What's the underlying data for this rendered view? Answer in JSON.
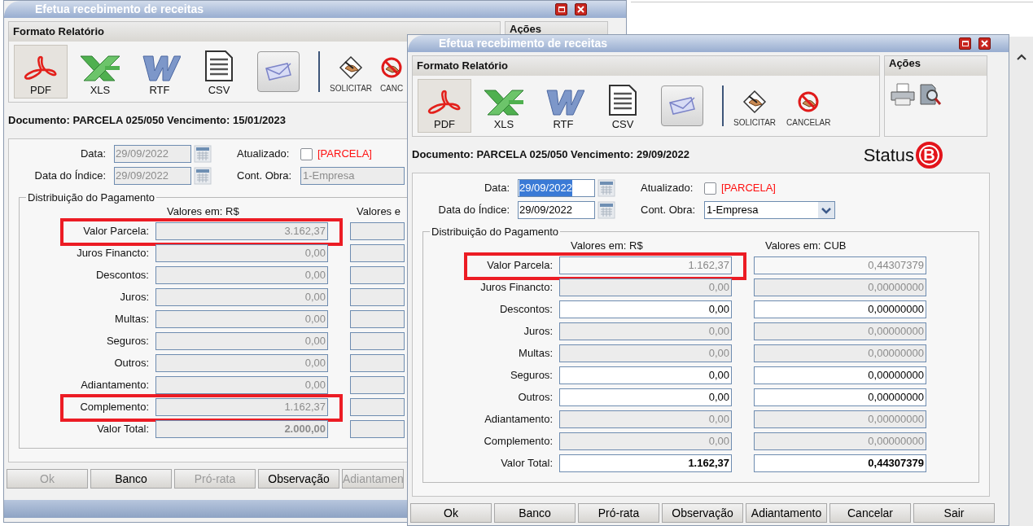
{
  "windows": [
    {
      "title": "Efetua recebimento de receitas",
      "report_panel": {
        "title": "Formato Relatório",
        "formats": [
          {
            "label": "PDF",
            "kind": "pdf",
            "selected": true
          },
          {
            "label": "XLS",
            "kind": "xls",
            "selected": false
          },
          {
            "label": "RTF",
            "kind": "rtf",
            "selected": false
          },
          {
            "label": "CSV",
            "kind": "csv",
            "selected": false
          },
          {
            "kind": "email",
            "selected": false
          }
        ],
        "actions": [
          {
            "label": "SOLICITAR",
            "kind": "request"
          },
          {
            "label": "CANC",
            "kind": "cancel"
          }
        ]
      },
      "actions_panel": {
        "title": "Ações"
      },
      "document": "Documento: PARCELA 025/050 Vencimento: 15/01/2023",
      "date_fields": [
        {
          "label": "Data:",
          "value": "29/09/2022",
          "disabled": true,
          "selected": false
        },
        {
          "label": "Data do Índice:",
          "value": "29/09/2022",
          "disabled": true,
          "selected": false
        }
      ],
      "updated": {
        "label": "Atualizado:",
        "checked": false,
        "note": "[PARCELA]"
      },
      "cont_obra": {
        "label": "Cont. Obra:",
        "value": "1-Empresa",
        "disabled": true
      },
      "distribution": {
        "title": "Distribuição do Pagamento",
        "column_headers": [
          "Valores em: R$",
          "Valores e"
        ],
        "rows": [
          {
            "label": "Valor Parcela:",
            "brl": "3.162,37",
            "kind": "disabled",
            "bold": false,
            "highlighted": true
          },
          {
            "label": "Juros Financto:",
            "brl": "0,00",
            "kind": "disabled",
            "bold": false,
            "highlighted": false
          },
          {
            "label": "Descontos:",
            "brl": "0,00",
            "kind": "disabled",
            "bold": false,
            "highlighted": false
          },
          {
            "label": "Juros:",
            "brl": "0,00",
            "kind": "disabled",
            "bold": false,
            "highlighted": false
          },
          {
            "label": "Multas:",
            "brl": "0,00",
            "kind": "disabled",
            "bold": false,
            "highlighted": false
          },
          {
            "label": "Seguros:",
            "brl": "0,00",
            "kind": "disabled",
            "bold": false,
            "highlighted": false
          },
          {
            "label": "Outros:",
            "brl": "0,00",
            "kind": "disabled",
            "bold": false,
            "highlighted": false
          },
          {
            "label": "Adiantamento:",
            "brl": "0,00",
            "kind": "disabled",
            "bold": false,
            "highlighted": false
          },
          {
            "label": "Complemento:",
            "brl": "1.162,37",
            "kind": "disabled",
            "bold": false,
            "highlighted": true
          },
          {
            "label": "Valor Total:",
            "brl": "2.000,00",
            "kind": "disabled",
            "bold": true,
            "highlighted": false
          }
        ]
      },
      "buttons": [
        {
          "label": "Ok",
          "disabled": true
        },
        {
          "label": "Banco",
          "disabled": false
        },
        {
          "label": "Pró-rata",
          "disabled": true
        },
        {
          "label": "Observação",
          "disabled": false
        },
        {
          "label": "Adiantamen",
          "disabled": true
        }
      ]
    },
    {
      "title": "Efetua recebimento de receitas",
      "report_panel": {
        "title": "Formato Relatório",
        "formats": [
          {
            "label": "PDF",
            "kind": "pdf",
            "selected": true
          },
          {
            "label": "XLS",
            "kind": "xls",
            "selected": false
          },
          {
            "label": "RTF",
            "kind": "rtf",
            "selected": false
          },
          {
            "label": "CSV",
            "kind": "csv",
            "selected": false
          },
          {
            "kind": "email",
            "selected": false
          }
        ],
        "actions": [
          {
            "label": "SOLICITAR",
            "kind": "request"
          },
          {
            "label": "CANCELAR",
            "kind": "cancel"
          }
        ]
      },
      "actions_panel": {
        "title": "Ações",
        "items": [
          {
            "kind": "print"
          },
          {
            "kind": "preview"
          }
        ]
      },
      "document": "Documento: PARCELA 025/050 Vencimento: 29/09/2022",
      "status": {
        "label": "Status",
        "badge": "B"
      },
      "date_fields": [
        {
          "label": "Data:",
          "value": "29/09/2022",
          "disabled": false,
          "selected": true
        },
        {
          "label": "Data do Índice:",
          "value": "29/09/2022",
          "disabled": false,
          "selected": false
        }
      ],
      "updated": {
        "label": "Atualizado:",
        "checked": false,
        "note": "[PARCELA]"
      },
      "cont_obra": {
        "label": "Cont. Obra:",
        "value": "1-Empresa",
        "disabled": false
      },
      "distribution": {
        "title": "Distribuição do Pagamento",
        "column_headers": [
          "Valores em: R$",
          "Valores em: CUB"
        ],
        "rows": [
          {
            "label": "Valor Parcela:",
            "brl": "1.162,37",
            "cub": "0,44307379",
            "kind": "readonly",
            "bold": false,
            "highlighted": true
          },
          {
            "label": "Juros Financto:",
            "brl": "0,00",
            "cub": "0,00000000",
            "kind": "disabled",
            "bold": false,
            "highlighted": false
          },
          {
            "label": "Descontos:",
            "brl": "0,00",
            "cub": "0,00000000",
            "kind": "editable",
            "bold": false,
            "highlighted": false
          },
          {
            "label": "Juros:",
            "brl": "0,00",
            "cub": "0,00000000",
            "kind": "disabled",
            "bold": false,
            "highlighted": false
          },
          {
            "label": "Multas:",
            "brl": "0,00",
            "cub": "0,00000000",
            "kind": "disabled",
            "bold": false,
            "highlighted": false
          },
          {
            "label": "Seguros:",
            "brl": "0,00",
            "cub": "0,00000000",
            "kind": "editable",
            "bold": false,
            "highlighted": false
          },
          {
            "label": "Outros:",
            "brl": "0,00",
            "cub": "0,00000000",
            "kind": "editable",
            "bold": false,
            "highlighted": false
          },
          {
            "label": "Adiantamento:",
            "brl": "0,00",
            "cub": "0,00000000",
            "kind": "disabled",
            "bold": false,
            "highlighted": false
          },
          {
            "label": "Complemento:",
            "brl": "0,00",
            "cub": "0,00000000",
            "kind": "disabled",
            "bold": false,
            "highlighted": false
          },
          {
            "label": "Valor Total:",
            "brl": "1.162,37",
            "cub": "0,44307379",
            "kind": "editable",
            "bold": true,
            "highlighted": false
          }
        ]
      },
      "buttons": [
        {
          "label": "Ok",
          "disabled": false
        },
        {
          "label": "Banco",
          "disabled": false
        },
        {
          "label": "Pró-rata",
          "disabled": false
        },
        {
          "label": "Observação",
          "disabled": false
        },
        {
          "label": "Adiantamento",
          "disabled": false
        },
        {
          "label": "Cancelar",
          "disabled": false
        },
        {
          "label": "Sair",
          "disabled": false
        }
      ]
    }
  ]
}
